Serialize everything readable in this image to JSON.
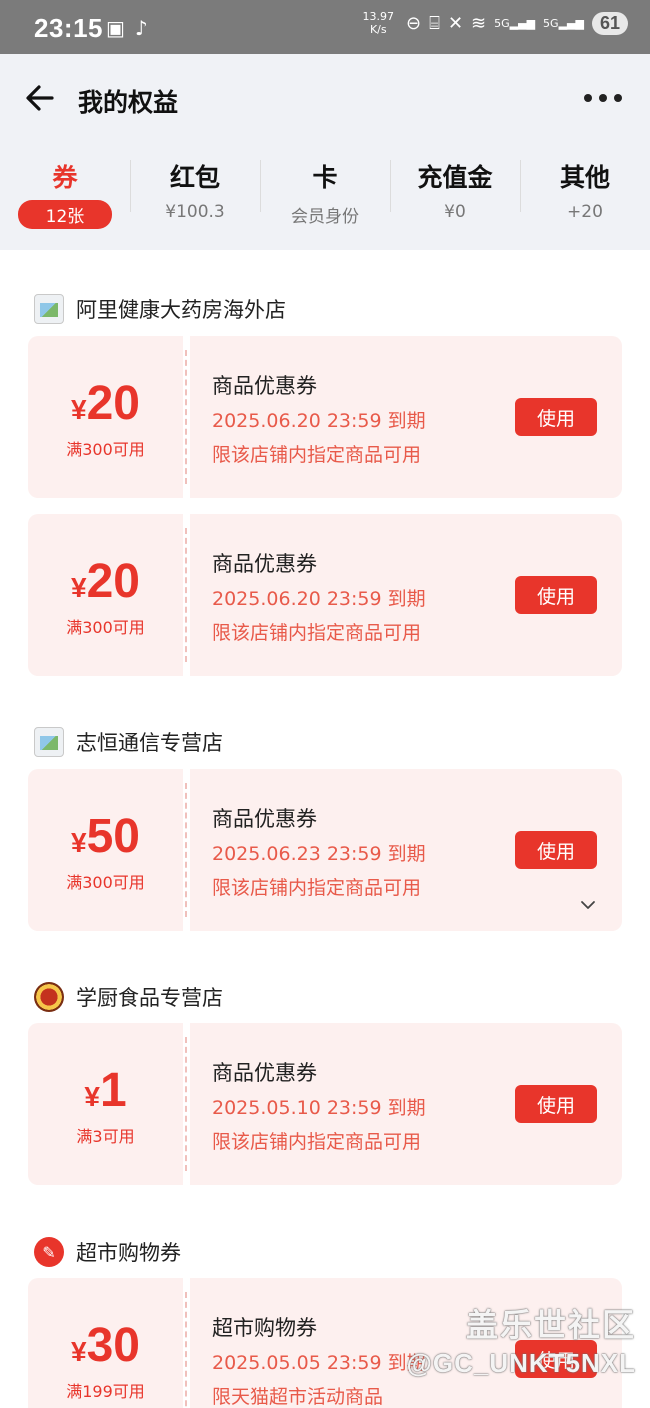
{
  "status_bar": {
    "time": "23:15",
    "speed_value": "13.97",
    "speed_unit": "K/s",
    "network_1": "5G",
    "network_2": "5G",
    "battery": "61"
  },
  "header": {
    "title": "我的权益"
  },
  "tabs": [
    {
      "label": "券",
      "sub": "12张"
    },
    {
      "label": "红包",
      "sub": "¥100.3"
    },
    {
      "label": "卡",
      "sub": "会员身份"
    },
    {
      "label": "充值金",
      "sub": "¥0"
    },
    {
      "label": "其他",
      "sub": "+20"
    }
  ],
  "groups": [
    {
      "store": "阿里健康大药房海外店",
      "coupons": [
        {
          "symbol": "¥",
          "amount": "20",
          "condition": "满300可用",
          "name": "商品优惠券",
          "expire": "2025.06.20 23:59 到期",
          "limit": "限该店铺内指定商品可用",
          "button": "使用"
        },
        {
          "symbol": "¥",
          "amount": "20",
          "condition": "满300可用",
          "name": "商品优惠券",
          "expire": "2025.06.20 23:59 到期",
          "limit": "限该店铺内指定商品可用",
          "button": "使用"
        }
      ]
    },
    {
      "store": "志恒通信专营店",
      "coupons": [
        {
          "symbol": "¥",
          "amount": "50",
          "condition": "满300可用",
          "name": "商品优惠券",
          "expire": "2025.06.23 23:59 到期",
          "limit": "限该店铺内指定商品可用",
          "button": "使用"
        }
      ]
    },
    {
      "store": "学厨食品专营店",
      "coupons": [
        {
          "symbol": "¥",
          "amount": "1",
          "condition": "满3可用",
          "name": "商品优惠券",
          "expire": "2025.05.10 23:59 到期",
          "limit": "限该店铺内指定商品可用",
          "button": "使用"
        }
      ]
    },
    {
      "store": "超市购物券",
      "coupons": [
        {
          "symbol": "¥",
          "amount": "30",
          "condition": "满199可用",
          "name": "超市购物券",
          "expire": "2025.05.05 23:59 到期",
          "limit": "限天猫超市活动商品",
          "button": "使用"
        }
      ]
    }
  ],
  "watermark": {
    "line1": "盖乐世社区",
    "line2": "@GC_UNKT5NXL"
  },
  "colors": {
    "accent": "#e8352b",
    "coupon_bg": "#fdf0ef",
    "header_bg": "#f0f2f6"
  }
}
